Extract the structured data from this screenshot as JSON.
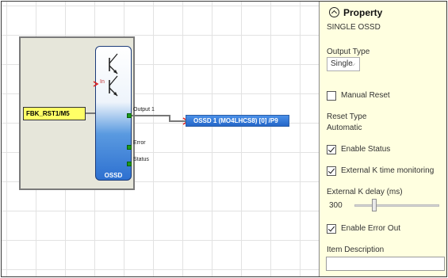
{
  "canvas": {
    "input_block": {
      "label": "FBK_RST1/M5"
    },
    "function_block": {
      "name": "OSSD",
      "ports": {
        "in": "In",
        "output1": "Output 1",
        "error": "Error",
        "status": "Status"
      }
    },
    "output_block": {
      "label": "OSSD 1 (MO4LHCS8) [0] /P9"
    }
  },
  "panel": {
    "title": "Property",
    "subtitle": "SINGLE OSSD",
    "output_type": {
      "label": "Output Type",
      "value": "Single"
    },
    "manual_reset": {
      "label": "Manual Reset",
      "checked": false
    },
    "reset_type": {
      "label": "Reset Type",
      "value": "Automatic"
    },
    "enable_status": {
      "label": "Enable Status",
      "checked": true
    },
    "external_k": {
      "label": "External K time monitoring",
      "checked": true
    },
    "external_k_delay": {
      "label": "External K delay (ms)",
      "value": "300",
      "level": 0.15
    },
    "enable_error_out": {
      "label": "Enable Error Out",
      "checked": true
    },
    "item_description": {
      "label": "Item Description",
      "value": ""
    }
  },
  "colors": {
    "panel_bg": "#ffffe0",
    "input_block": "#ffff66",
    "output_block": "#2466c8",
    "port": "#1a9a1a",
    "connector_red": "#e02020"
  }
}
